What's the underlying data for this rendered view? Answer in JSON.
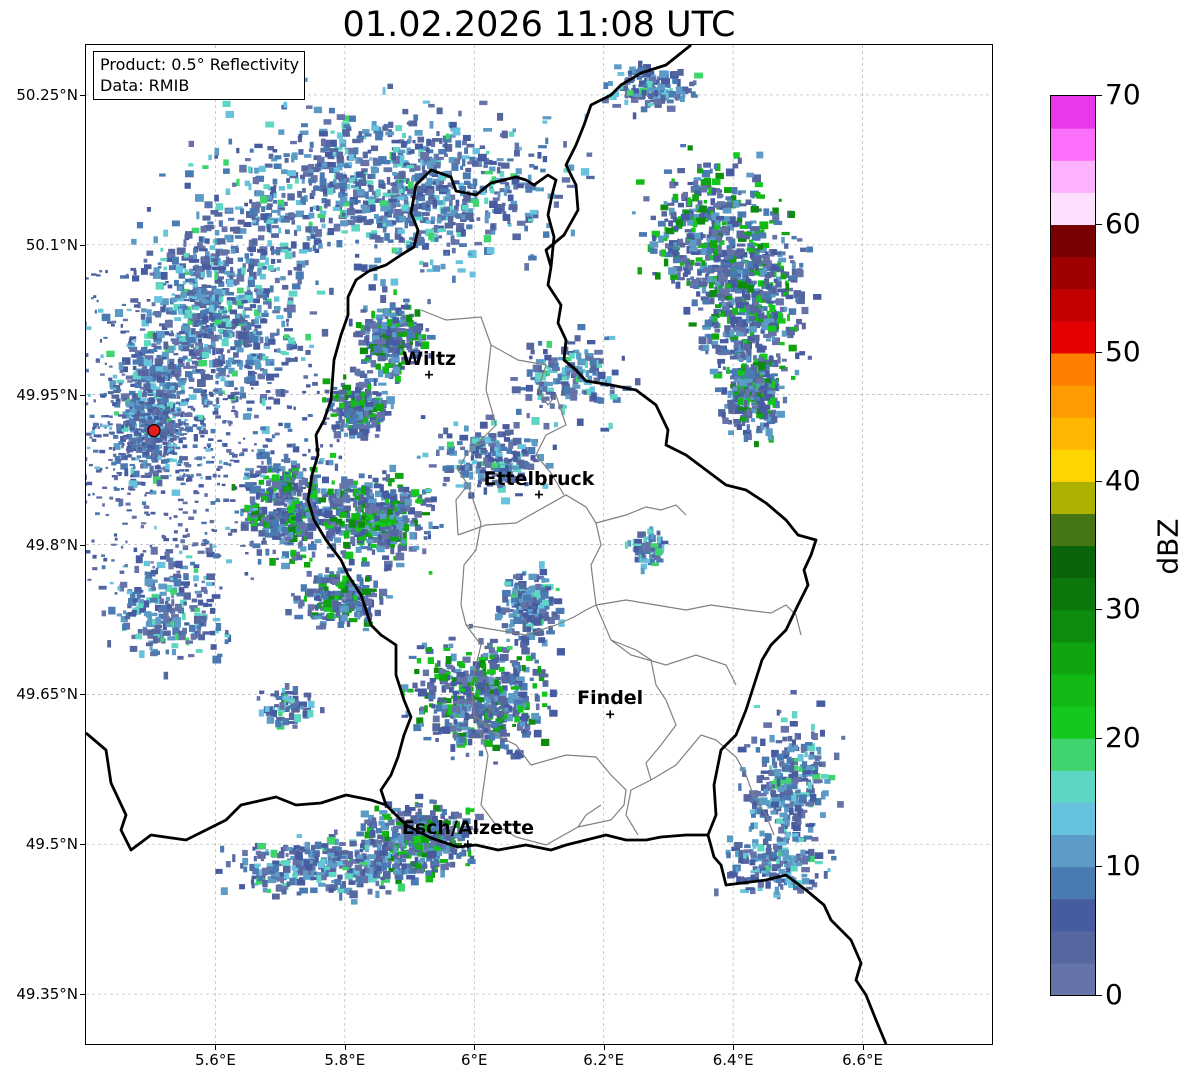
{
  "map": {
    "title": "01.02.2026 11:08 UTC",
    "info": {
      "product": "Product: 0.5° Reflectivity",
      "source": "Data: RMIB"
    },
    "extent": {
      "lon_min": 5.4,
      "lon_max": 6.8,
      "lat_min": 49.3,
      "lat_max": 50.3
    },
    "lat_ticks": [
      {
        "value": 50.25,
        "label": "50.25°N"
      },
      {
        "value": 50.1,
        "label": "50.1°N"
      },
      {
        "value": 49.95,
        "label": "49.95°N"
      },
      {
        "value": 49.8,
        "label": "49.8°N"
      },
      {
        "value": 49.65,
        "label": "49.65°N"
      },
      {
        "value": 49.5,
        "label": "49.5°N"
      },
      {
        "value": 49.35,
        "label": "49.35°N"
      }
    ],
    "lon_ticks": [
      {
        "value": 5.6,
        "label": "5.6°E"
      },
      {
        "value": 5.8,
        "label": "5.8°E"
      },
      {
        "value": 6.0,
        "label": "6°E"
      },
      {
        "value": 6.2,
        "label": "6.2°E"
      },
      {
        "value": 6.4,
        "label": "6.4°E"
      },
      {
        "value": 6.6,
        "label": "6.6°E"
      }
    ],
    "cities": [
      {
        "name": "Wiltz",
        "lon": 5.93,
        "lat": 49.97
      },
      {
        "name": "Ettelbruck",
        "lon": 6.1,
        "lat": 49.85
      },
      {
        "name": "Findel",
        "lon": 6.21,
        "lat": 49.63
      },
      {
        "name": "Esch/Alzette",
        "lon": 5.99,
        "lat": 49.5
      }
    ],
    "radar_site": {
      "lon": 5.505,
      "lat": 49.914,
      "color": "#e41a1c"
    },
    "border_color": "#000000",
    "admin_color": "#808080"
  },
  "colorbar": {
    "label": "dBZ",
    "min": 0,
    "max": 70,
    "step": 2.5,
    "ticks": [
      "0",
      "10",
      "20",
      "30",
      "40",
      "50",
      "60",
      "70"
    ],
    "tick_values": [
      0,
      10,
      20,
      30,
      40,
      50,
      60,
      70
    ],
    "colors": [
      "#6573a8",
      "#5667a0",
      "#475ca0",
      "#4a7ab2",
      "#5b9bc6",
      "#66c2dd",
      "#5ed6c4",
      "#3fd46e",
      "#14c81e",
      "#12b814",
      "#10a410",
      "#0e8c0e",
      "#0c780c",
      "#0a640a",
      "#457613",
      "#adb100",
      "#fed500",
      "#feb600",
      "#fe9b00",
      "#fe7e00",
      "#e40000",
      "#c20000",
      "#9e0000",
      "#780000",
      "#fde0fd",
      "#fdb2fd",
      "#fb6ffb",
      "#e838ea"
    ]
  }
}
